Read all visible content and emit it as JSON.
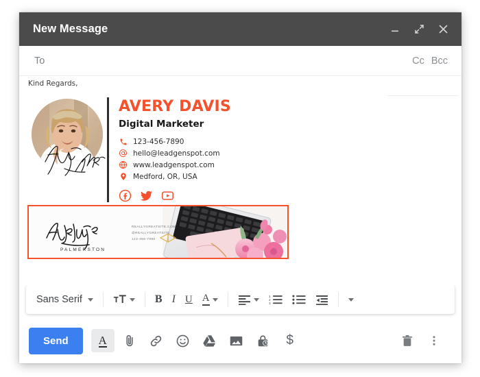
{
  "window": {
    "title": "New Message",
    "controls": [
      {
        "name": "minimize",
        "label": "–"
      },
      {
        "name": "expand",
        "label": "↗"
      },
      {
        "name": "close",
        "label": "×"
      }
    ]
  },
  "recipients": {
    "to_placeholder": "To",
    "cc_label": "Cc",
    "bcc_label": "Bcc"
  },
  "message": {
    "greeting": "Kind Regards,"
  },
  "signature": {
    "name": "AVERY DAVIS",
    "role": "Digital Marketer",
    "signature_script": "Avery Davis",
    "accent_color": "#f4512c",
    "contacts": [
      {
        "icon": "phone-icon",
        "text": "123-456-7890"
      },
      {
        "icon": "email-at-icon",
        "text": "hello@leadgenspot.com"
      },
      {
        "icon": "globe-icon",
        "text": "www.leadgenspot.com"
      },
      {
        "icon": "location-pin-icon",
        "text": "Medford, OR, USA"
      }
    ],
    "socials": [
      {
        "icon": "facebook-icon",
        "label": "Facebook"
      },
      {
        "icon": "twitter-icon",
        "label": "Twitter"
      },
      {
        "icon": "youtube-icon",
        "label": "YouTube"
      }
    ]
  },
  "banner": {
    "logo_script": "Adeline",
    "logo_subtitle": "PALMERSTON",
    "lines": [
      "REALLYGREATSITE.COM",
      "@REALLYGREATSITE",
      "123-456-7890"
    ],
    "border_color": "#f4512c"
  },
  "format_toolbar": {
    "font_name": "Sans Serif",
    "items": [
      {
        "name": "font-family-select",
        "label": "Sans Serif"
      },
      {
        "name": "font-size-button",
        "label": "tT"
      },
      {
        "name": "bold-button",
        "label": "B"
      },
      {
        "name": "italic-button",
        "label": "I"
      },
      {
        "name": "underline-button",
        "label": "U"
      },
      {
        "name": "text-color-button",
        "label": "A"
      },
      {
        "name": "align-button",
        "label": "align"
      },
      {
        "name": "numbered-list-button",
        "label": "1."
      },
      {
        "name": "bulleted-list-button",
        "label": "•"
      },
      {
        "name": "indent-less-button",
        "label": "indent"
      },
      {
        "name": "more-options-button",
        "label": "▾"
      }
    ]
  },
  "actions": {
    "send_label": "Send",
    "items": [
      {
        "name": "formatting-options-button",
        "icon": "underlined-a-icon",
        "active": true
      },
      {
        "name": "attach-file-button",
        "icon": "paperclip-icon"
      },
      {
        "name": "insert-link-button",
        "icon": "link-icon"
      },
      {
        "name": "insert-emoji-button",
        "icon": "emoji-icon"
      },
      {
        "name": "insert-drive-button",
        "icon": "google-drive-icon"
      },
      {
        "name": "insert-photo-button",
        "icon": "image-icon"
      },
      {
        "name": "confidential-mode-button",
        "icon": "lock-clock-icon"
      },
      {
        "name": "insert-money-button",
        "icon": "dollar-icon"
      }
    ],
    "trash": {
      "name": "discard-draft-button",
      "icon": "trash-icon"
    },
    "more": {
      "name": "more-options-button",
      "icon": "kebab-menu-icon"
    }
  }
}
